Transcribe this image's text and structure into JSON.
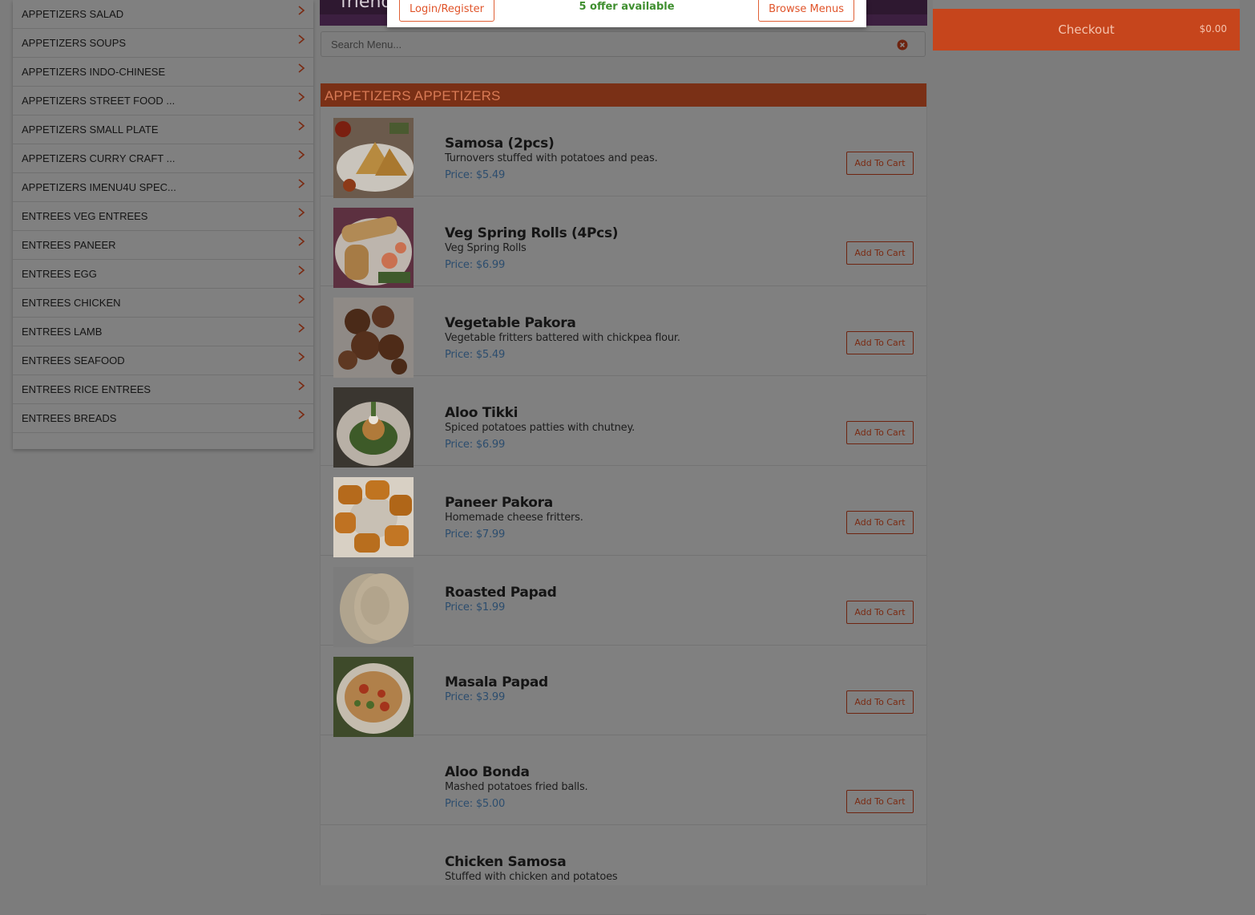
{
  "sidebar": {
    "categories": [
      {
        "label": "APPETIZERS SALAD"
      },
      {
        "label": "APPETIZERS SOUPS"
      },
      {
        "label": "APPETIZERS INDO-CHINESE"
      },
      {
        "label": "APPETIZERS STREET FOOD ..."
      },
      {
        "label": "APPETIZERS SMALL PLATE"
      },
      {
        "label": "APPETIZERS CURRY CRAFT ..."
      },
      {
        "label": "APPETIZERS IMENU4U SPEC..."
      },
      {
        "label": "ENTREES VEG ENTREES"
      },
      {
        "label": "ENTREES PANEER"
      },
      {
        "label": "ENTREES EGG"
      },
      {
        "label": "ENTREES CHICKEN"
      },
      {
        "label": "ENTREES LAMB"
      },
      {
        "label": "ENTREES SEAFOOD"
      },
      {
        "label": "ENTREES RICE ENTREES"
      },
      {
        "label": "ENTREES BREADS"
      }
    ]
  },
  "banner": {
    "text": "friend"
  },
  "offer_bar": {
    "login_label": "Login/Register",
    "offer_text": "5 offer available",
    "browse_label": "Browse Menus"
  },
  "search": {
    "placeholder": "Search Menu..."
  },
  "menu": {
    "section_title": "APPETIZERS APPETIZERS",
    "add_label": "Add To Cart",
    "items": [
      {
        "name": "Samosa (2pcs)",
        "description": "Turnovers stuffed with potatoes and peas.",
        "price": "Price: $5.49"
      },
      {
        "name": "Veg Spring Rolls (4Pcs)",
        "description": "Veg Spring Rolls",
        "price": "Price: $6.99"
      },
      {
        "name": "Vegetable Pakora",
        "description": "Vegetable fritters battered with chickpea flour.",
        "price": "Price: $5.49"
      },
      {
        "name": "Aloo Tikki",
        "description": "Spiced potatoes patties with chutney.",
        "price": "Price: $6.99"
      },
      {
        "name": "Paneer Pakora",
        "description": "Homemade cheese fritters.",
        "price": "Price: $7.99"
      },
      {
        "name": "Roasted Papad",
        "description": "",
        "price": "Price: $1.99"
      },
      {
        "name": "Masala Papad",
        "description": "",
        "price": "Price: $3.99"
      },
      {
        "name": "Aloo Bonda",
        "description": "Mashed potatoes fried balls.",
        "price": "Price: $5.00"
      },
      {
        "name": "Chicken Samosa",
        "description": "Stuffed with chicken and potatoes",
        "price": ""
      }
    ]
  },
  "cart": {
    "checkout_label": "Checkout",
    "total": "$0.00"
  },
  "colors": {
    "accent": "#c6451c",
    "section_header": "#7a3016",
    "offer_green": "#3f8f2f",
    "price_blue": "#2c4d6e"
  }
}
